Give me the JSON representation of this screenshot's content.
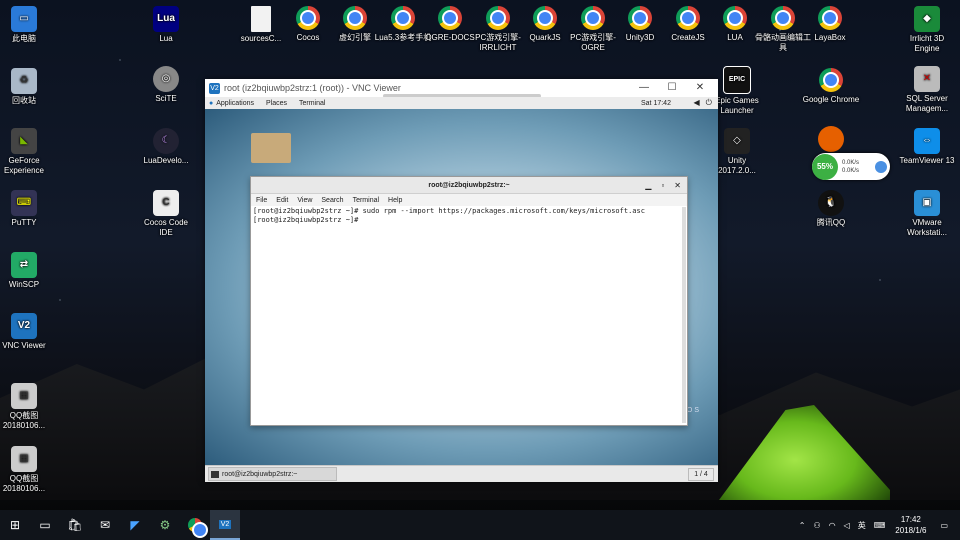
{
  "desktop": {
    "icons_left": [
      {
        "label": "此电脑",
        "icon": "computer-icon"
      },
      {
        "label": "回收站",
        "icon": "recycle-bin-icon"
      },
      {
        "label": "GeForce Experience",
        "icon": "geforce-icon"
      },
      {
        "label": "PuTTY",
        "icon": "putty-icon"
      },
      {
        "label": "WinSCP",
        "icon": "winscp-icon"
      },
      {
        "label": "VNC Viewer",
        "icon": "vnc-viewer-icon"
      },
      {
        "label": "QQ截图 20180106...",
        "icon": "image-file-icon"
      },
      {
        "label": "QQ截图 20180106...",
        "icon": "image-file-icon"
      }
    ],
    "icons_col2": [
      {
        "label": "Lua",
        "icon": "lua-icon"
      },
      {
        "label": "SciTE",
        "icon": "scite-icon"
      },
      {
        "label": "LuaDevelo...",
        "icon": "luadevelop-icon"
      },
      {
        "label": "Cocos Code IDE",
        "icon": "cocos-ide-icon"
      }
    ],
    "icons_top": [
      {
        "label": "sourcesC...",
        "icon": "file-icon"
      },
      {
        "label": "Cocos",
        "icon": "chrome-icon"
      },
      {
        "label": "虚幻引擎",
        "icon": "chrome-icon"
      },
      {
        "label": "Lua5.3参考手机",
        "icon": "chrome-icon"
      },
      {
        "label": "OGRE-DOCS",
        "icon": "chrome-icon"
      },
      {
        "label": "PC游戏引擎-IRRLICHT",
        "icon": "chrome-icon"
      },
      {
        "label": "QuarkJS",
        "icon": "chrome-icon"
      },
      {
        "label": "PC游戏引擎-OGRE",
        "icon": "chrome-icon"
      },
      {
        "label": "Unity3D",
        "icon": "chrome-icon"
      },
      {
        "label": "CreateJS",
        "icon": "chrome-icon"
      },
      {
        "label": "LUA",
        "icon": "chrome-icon"
      },
      {
        "label": "骨骼动画编辑工具",
        "icon": "chrome-icon"
      },
      {
        "label": "LayaBox",
        "icon": "chrome-icon"
      }
    ],
    "icons_right": [
      {
        "label": "Irrlicht 3D Engine",
        "icon": "irrlicht-icon"
      },
      {
        "label": "SQL Server Managem...",
        "icon": "sql-server-icon"
      },
      {
        "label": "TeamViewer 13",
        "icon": "teamviewer-icon"
      },
      {
        "label": "VMware Workstati...",
        "icon": "vmware-icon"
      }
    ],
    "icons_right2": [
      {
        "label": "Epic Games Launcher",
        "icon": "epic-games-icon"
      },
      {
        "label": "Google Chrome",
        "icon": "chrome-icon"
      },
      {
        "label": "Unity 2017.2.0...",
        "icon": "unity-icon"
      },
      {
        "label": "腾讯QQ",
        "icon": "qq-icon"
      }
    ],
    "net_widget": {
      "percent": "55%",
      "up": "0.0K/s",
      "down": "0.0K/s"
    }
  },
  "vnc": {
    "title": "root (iz2bqiuwbp2strz:1 (root)) - VNC Viewer",
    "gnome": {
      "applications": "Applications",
      "places": "Places",
      "terminal": "Terminal",
      "clock": "Sat 17:42"
    },
    "centos_label": "CENTOS",
    "terminal": {
      "title": "root@iz2bqiuwbp2strz:~",
      "menu": [
        "File",
        "Edit",
        "View",
        "Search",
        "Terminal",
        "Help"
      ],
      "line1": "[root@iz2bqiuwbp2strz ~]# sudo rpm --import https://packages.microsoft.com/keys/microsoft.asc",
      "line2": "[root@iz2bqiuwbp2strz ~]# "
    },
    "bottom_panel": {
      "task_label": "root@iz2bqiuwbp2strz:~",
      "workspace": "1 / 4"
    }
  },
  "taskbar": {
    "ime": "英",
    "time": "17:42",
    "date": "2018/1/6"
  }
}
